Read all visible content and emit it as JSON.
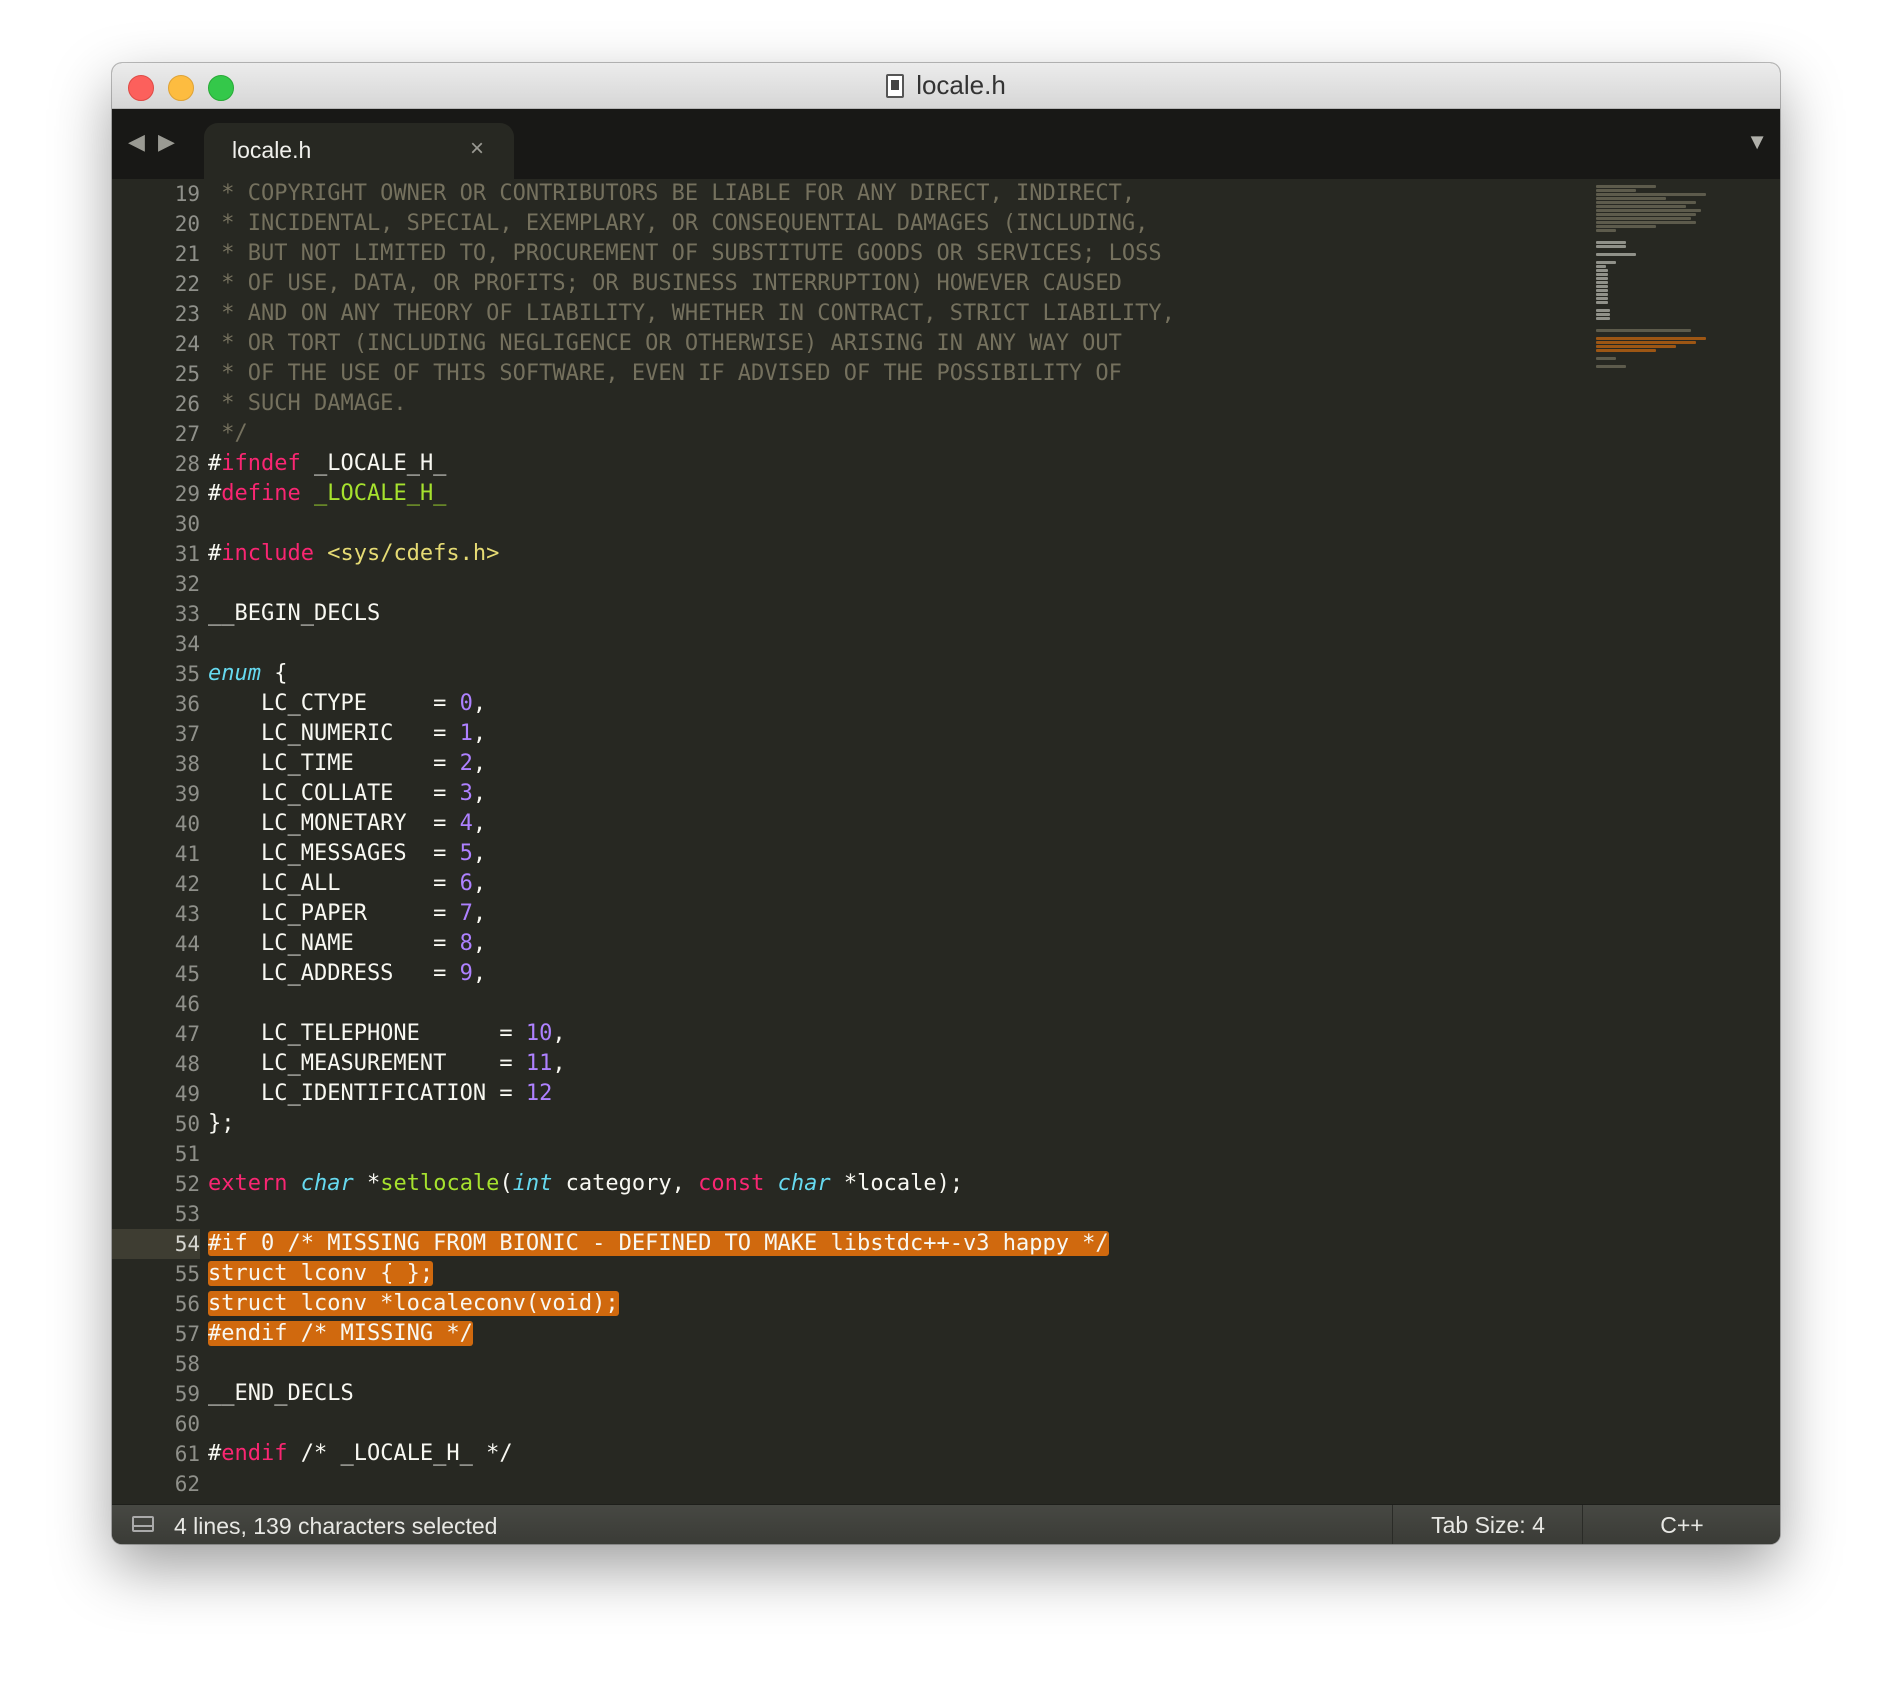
{
  "window": {
    "title": "locale.h"
  },
  "tabs": [
    {
      "label": "locale.h",
      "close": "×"
    }
  ],
  "nav": {
    "back": "◀",
    "forward": "▶",
    "menu": "▼"
  },
  "line_numbers": [
    "19",
    "20",
    "21",
    "22",
    "23",
    "24",
    "25",
    "26",
    "27",
    "28",
    "29",
    "30",
    "31",
    "32",
    "33",
    "34",
    "35",
    "36",
    "37",
    "38",
    "39",
    "40",
    "41",
    "42",
    "43",
    "44",
    "45",
    "46",
    "47",
    "48",
    "49",
    "50",
    "51",
    "52",
    "53",
    "54",
    "55",
    "56",
    "57",
    "58",
    "59",
    "60",
    "61",
    "62"
  ],
  "active_line": "54",
  "code": {
    "l19": " * COPYRIGHT OWNER OR CONTRIBUTORS BE LIABLE FOR ANY DIRECT, INDIRECT,",
    "l20": " * INCIDENTAL, SPECIAL, EXEMPLARY, OR CONSEQUENTIAL DAMAGES (INCLUDING,",
    "l21": " * BUT NOT LIMITED TO, PROCUREMENT OF SUBSTITUTE GOODS OR SERVICES; LOSS",
    "l22": " * OF USE, DATA, OR PROFITS; OR BUSINESS INTERRUPTION) HOWEVER CAUSED",
    "l23": " * AND ON ANY THEORY OF LIABILITY, WHETHER IN CONTRACT, STRICT LIABILITY,",
    "l24": " * OR TORT (INCLUDING NEGLIGENCE OR OTHERWISE) ARISING IN ANY WAY OUT",
    "l25": " * OF THE USE OF THIS SOFTWARE, EVEN IF ADVISED OF THE POSSIBILITY OF",
    "l26": " * SUCH DAMAGE.",
    "l27": " */",
    "hash": "#",
    "ifndef": "ifndef",
    "define": "define",
    "include": "include",
    "guard": " _LOCALE_H_",
    "header": " <sys/cdefs.h>",
    "begin_decls": "__BEGIN_DECLS",
    "enum_kw": "enum",
    "enum_open": " {",
    "enum_items": [
      {
        "name": "    LC_CTYPE     = ",
        "value": "0",
        "sep": ","
      },
      {
        "name": "    LC_NUMERIC   = ",
        "value": "1",
        "sep": ","
      },
      {
        "name": "    LC_TIME      = ",
        "value": "2",
        "sep": ","
      },
      {
        "name": "    LC_COLLATE   = ",
        "value": "3",
        "sep": ","
      },
      {
        "name": "    LC_MONETARY  = ",
        "value": "4",
        "sep": ","
      },
      {
        "name": "    LC_MESSAGES  = ",
        "value": "5",
        "sep": ","
      },
      {
        "name": "    LC_ALL       = ",
        "value": "6",
        "sep": ","
      },
      {
        "name": "    LC_PAPER     = ",
        "value": "7",
        "sep": ","
      },
      {
        "name": "    LC_NAME      = ",
        "value": "8",
        "sep": ","
      },
      {
        "name": "    LC_ADDRESS   = ",
        "value": "9",
        "sep": ","
      },
      {
        "name": "    LC_TELEPHONE      = ",
        "value": "10",
        "sep": ","
      },
      {
        "name": "    LC_MEASUREMENT    = ",
        "value": "11",
        "sep": ","
      },
      {
        "name": "    LC_IDENTIFICATION = ",
        "value": "12",
        "sep": ""
      }
    ],
    "enum_close": "};",
    "extern": "extern",
    "char1": "char",
    "star_set": " *",
    "setlocale": "setlocale",
    "paren_open": "(",
    "int_kw": "int",
    "category": " category, ",
    "const": "const",
    "char2": "char",
    "locale_arg": " *locale);",
    "sel1": "#if 0 /* MISSING FROM BIONIC - DEFINED TO MAKE libstdc++-v3 happy */",
    "sel2": "struct lconv { };",
    "sel3": "struct lconv *localeconv(void);",
    "sel4": "#endif /* MISSING */",
    "end_decls": "__END_DECLS",
    "endif_kw": "endif",
    "endif_cmt": " /* _LOCALE_H_ */"
  },
  "status": {
    "selection": "4 lines, 139 characters selected",
    "tab_size": "Tab Size: 4",
    "syntax": "C++"
  },
  "colors": {
    "background": "#272822",
    "comment": "#75715e",
    "keyword": "#f92672",
    "type": "#66d9ef",
    "number": "#ae81ff",
    "string": "#e6db74",
    "function": "#a6e22e",
    "selection": "#d0690e"
  }
}
